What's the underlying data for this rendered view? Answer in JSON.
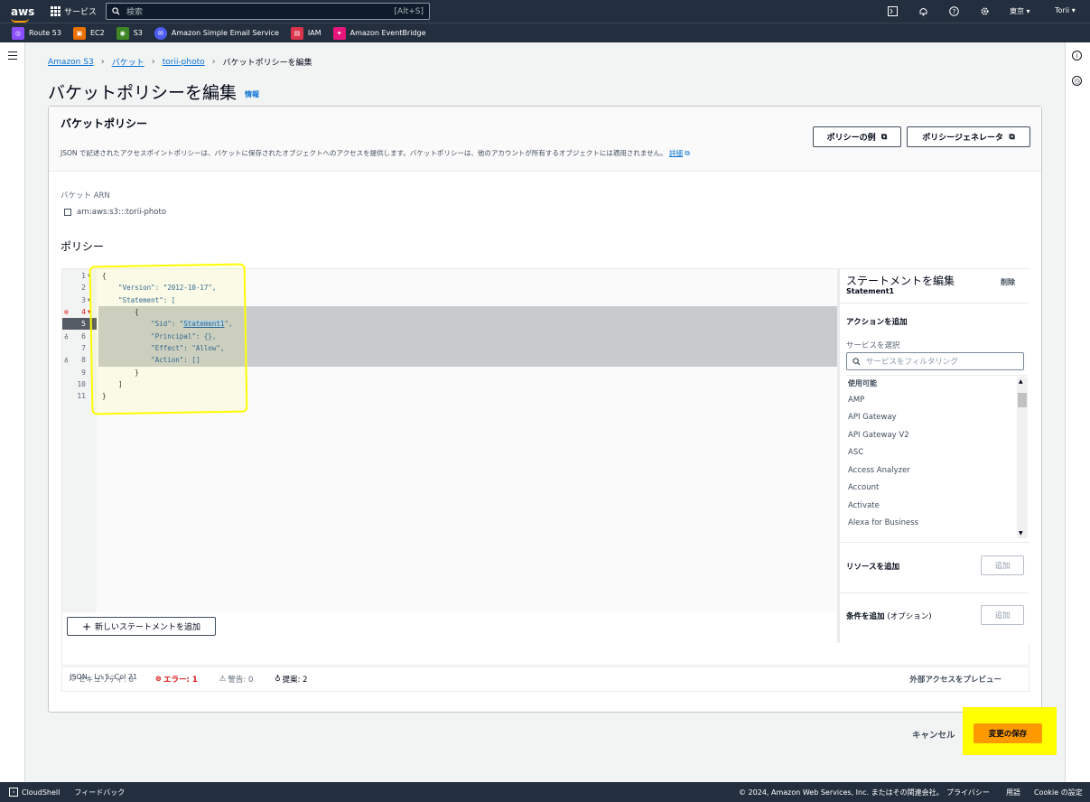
{
  "topnav": {
    "logo": "aws",
    "services": "サービス",
    "search_placeholder": "検索",
    "search_shortcut": "[Alt+S]",
    "region": "東京 ▾",
    "user": "Torii ▾"
  },
  "favorites": [
    {
      "label": "Route 53",
      "color": "#8c4fff",
      "icon": "route53-icon"
    },
    {
      "label": "EC2",
      "color": "#ed7100",
      "icon": "ec2-icon"
    },
    {
      "label": "S3",
      "color": "#3f8624",
      "icon": "s3-icon"
    },
    {
      "label": "Amazon Simple Email Service",
      "color": "#4d5df0",
      "icon": "ses-icon"
    },
    {
      "label": "IAM",
      "color": "#dd344c",
      "icon": "iam-icon"
    },
    {
      "label": "Amazon EventBridge",
      "color": "#e7157b",
      "icon": "eventbridge-icon"
    }
  ],
  "breadcrumb": {
    "items": [
      "Amazon S3",
      "バケット",
      "torii-photo"
    ],
    "current": "バケットポリシーを編集"
  },
  "page": {
    "title": "バケットポリシーを編集",
    "info": "情報"
  },
  "section": {
    "title": "バケットポリシー",
    "description": "JSON で記述されたアクセスポイントポリシーは、バケットに保存されたオブジェクトへのアクセスを提供します。バケットポリシーは、他のアカウントが所有するオブジェクトには適用されません。",
    "detail_link": "詳細",
    "policy_examples_button": "ポリシーの例",
    "policy_generator_button": "ポリシージェネレータ"
  },
  "bucket_arn": {
    "label": "バケット ARN",
    "value": "arn:aws:s3:::torii-photo"
  },
  "policy": {
    "heading": "ポリシー"
  },
  "editor": {
    "line_numbers": [
      "1",
      "2",
      "3",
      "4",
      "5",
      "6",
      "7",
      "8",
      "9",
      "10",
      "11"
    ],
    "lines": [
      "{",
      "    \"Version\": \"2012-10-17\",",
      "    \"Statement\": [",
      "        {",
      "            \"Sid\": \"Statement1\",",
      "            \"Principal\": {},",
      "            \"Effect\": \"Allow\",",
      "            \"Action\": []",
      "        }",
      "    ]",
      "}"
    ],
    "add_statement_button": "新しいステートメントを追加",
    "status_lang": "JSON",
    "status_pos": "Ln 5, Col 21"
  },
  "panel": {
    "title": "ステートメントを編集",
    "subtitle": "Statement1",
    "delete": "削除",
    "add_action": "アクションを追加",
    "select_service": "サービスを選択",
    "filter_placeholder": "サービスをフィルタリング",
    "group_label": "使用可能",
    "services": [
      "AMP",
      "API Gateway",
      "API Gateway V2",
      "ASC",
      "Access Analyzer",
      "Account",
      "Activate",
      "Alexa for Business"
    ],
    "add_resource": "リソースを追加",
    "add_condition": "条件を追加",
    "add_condition_optional": "(オプション)",
    "add_button": "追加"
  },
  "issues": {
    "security": "セキュリティ: 0",
    "errors": "エラー: 1",
    "warnings": "警告: 0",
    "suggestions": "提案: 2",
    "preview": "外部アクセスをプレビュー"
  },
  "actions": {
    "cancel": "キャンセル",
    "save": "変更の保存"
  },
  "footer": {
    "cloudshell": "CloudShell",
    "feedback": "フィードバック",
    "copyright": "© 2024, Amazon Web Services, Inc. またはその関連会社。",
    "privacy": "プライバシー",
    "terms": "用語",
    "cookie": "Cookie の設定"
  }
}
